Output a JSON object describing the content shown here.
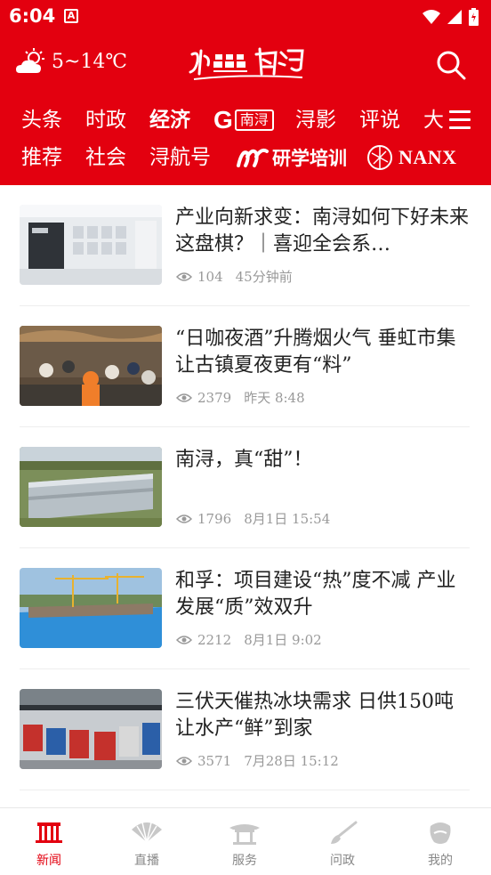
{
  "status_bar": {
    "time": "6:04",
    "notification_glyph": "A"
  },
  "header": {
    "weather_icon": "cloud-sun-icon",
    "temperature": "5~14℃",
    "logo_icon": "shuixiang-nanxun-logo",
    "search_icon": "search-icon"
  },
  "nav": {
    "row1": [
      "头条",
      "时政",
      "经济",
      "南浔",
      "浔影",
      "评说",
      "大"
    ],
    "g_letter": "G",
    "row2": [
      "推荐",
      "社会",
      "浔航号"
    ],
    "yanxue_label": "研学培训",
    "nanx_label": "NANX",
    "active": "经济"
  },
  "news": [
    {
      "title": "产业向新求变：南浔如何下好未来这盘棋？｜喜迎全会系…",
      "views": "104",
      "time": "45分钟前"
    },
    {
      "title": "“日咖夜酒”升腾烟火气 垂虹市集让古镇夏夜更有“料”",
      "views": "2379",
      "time": "昨天  8:48"
    },
    {
      "title": "南浔，真“甜”！",
      "views": "1796",
      "time": "8月1日  15:54"
    },
    {
      "title": "和孚：项目建设“热”度不减 产业发展“质”效双升",
      "views": "2212",
      "time": "8月1日  9:02"
    },
    {
      "title": "三伏天催热冰块需求 日供150吨让水产“鲜”到家",
      "views": "3571",
      "time": "7月28日  15:12"
    }
  ],
  "tabbar": [
    {
      "label": "新闻",
      "icon": "news-gate-icon",
      "active": true
    },
    {
      "label": "直播",
      "icon": "live-fan-icon",
      "active": false
    },
    {
      "label": "服务",
      "icon": "service-pavilion-icon",
      "active": false
    },
    {
      "label": "问政",
      "icon": "brush-icon",
      "active": false
    },
    {
      "label": "我的",
      "icon": "profile-icon",
      "active": false
    }
  ],
  "colors": {
    "brand_red": "#e3000f",
    "meta_gray": "#999999"
  }
}
